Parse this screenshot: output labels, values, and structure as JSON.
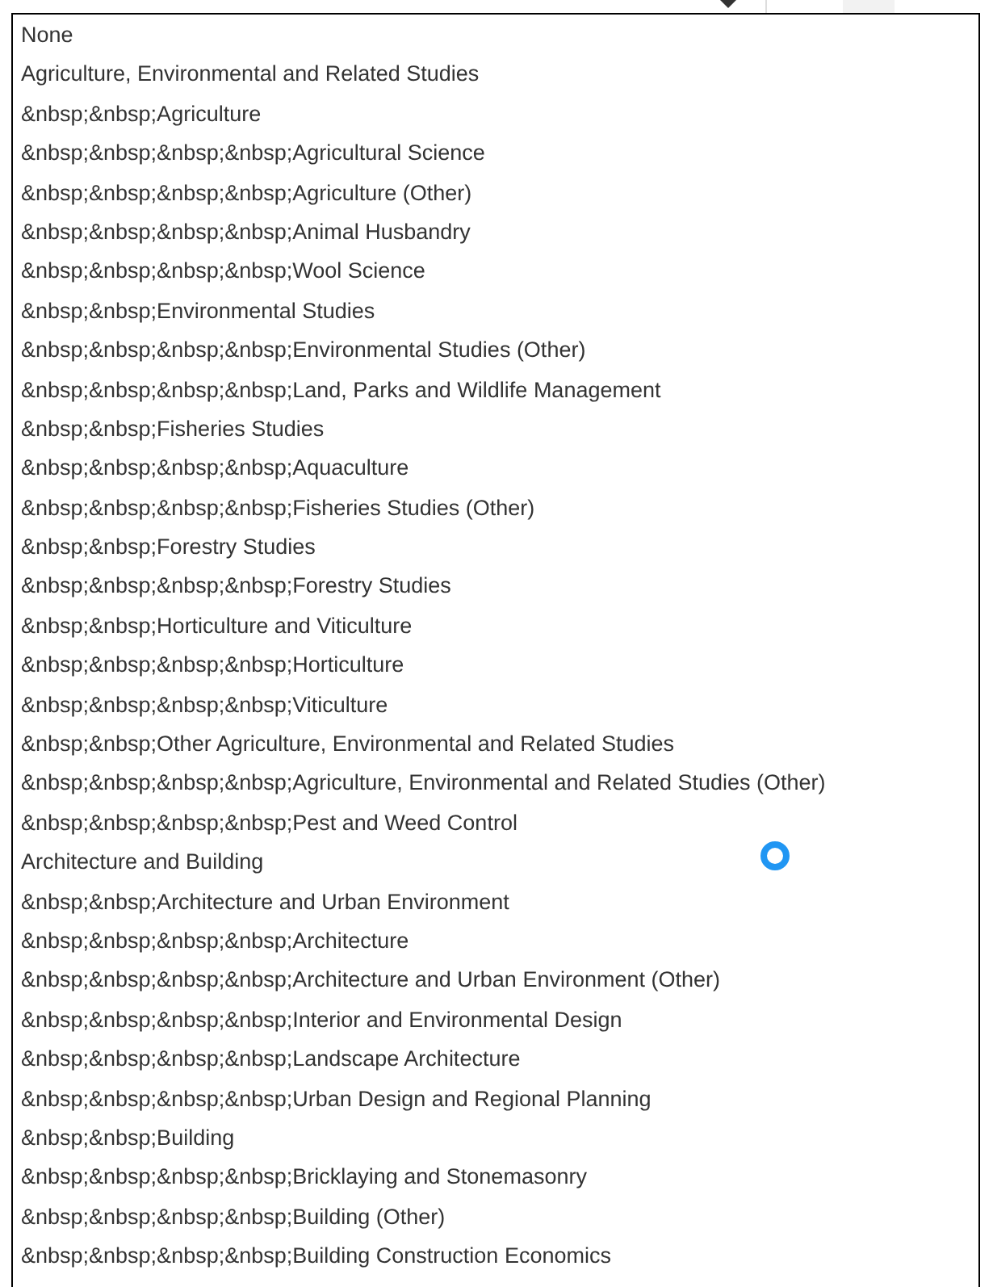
{
  "dropdown": {
    "options": [
      {
        "label": "None"
      },
      {
        "label": "Agriculture, Environmental and Related Studies"
      },
      {
        "label": "&nbsp;&nbsp;Agriculture"
      },
      {
        "label": "&nbsp;&nbsp;&nbsp;&nbsp;Agricultural Science"
      },
      {
        "label": "&nbsp;&nbsp;&nbsp;&nbsp;Agriculture (Other)"
      },
      {
        "label": "&nbsp;&nbsp;&nbsp;&nbsp;Animal Husbandry"
      },
      {
        "label": "&nbsp;&nbsp;&nbsp;&nbsp;Wool Science"
      },
      {
        "label": "&nbsp;&nbsp;Environmental Studies"
      },
      {
        "label": "&nbsp;&nbsp;&nbsp;&nbsp;Environmental Studies (Other)"
      },
      {
        "label": "&nbsp;&nbsp;&nbsp;&nbsp;Land, Parks and Wildlife Management"
      },
      {
        "label": "&nbsp;&nbsp;Fisheries Studies"
      },
      {
        "label": "&nbsp;&nbsp;&nbsp;&nbsp;Aquaculture"
      },
      {
        "label": "&nbsp;&nbsp;&nbsp;&nbsp;Fisheries Studies (Other)"
      },
      {
        "label": "&nbsp;&nbsp;Forestry Studies"
      },
      {
        "label": "&nbsp;&nbsp;&nbsp;&nbsp;Forestry Studies"
      },
      {
        "label": "&nbsp;&nbsp;Horticulture and Viticulture"
      },
      {
        "label": "&nbsp;&nbsp;&nbsp;&nbsp;Horticulture"
      },
      {
        "label": "&nbsp;&nbsp;&nbsp;&nbsp;Viticulture"
      },
      {
        "label": "&nbsp;&nbsp;Other Agriculture, Environmental and Related Studies"
      },
      {
        "label": "&nbsp;&nbsp;&nbsp;&nbsp;Agriculture, Environmental and Related Studies (Other)"
      },
      {
        "label": "&nbsp;&nbsp;&nbsp;&nbsp;Pest and Weed Control"
      },
      {
        "label": "Architecture and Building"
      },
      {
        "label": "&nbsp;&nbsp;Architecture and Urban Environment"
      },
      {
        "label": "&nbsp;&nbsp;&nbsp;&nbsp;Architecture"
      },
      {
        "label": "&nbsp;&nbsp;&nbsp;&nbsp;Architecture and Urban Environment (Other)"
      },
      {
        "label": "&nbsp;&nbsp;&nbsp;&nbsp;Interior and Environmental Design"
      },
      {
        "label": "&nbsp;&nbsp;&nbsp;&nbsp;Landscape Architecture"
      },
      {
        "label": "&nbsp;&nbsp;&nbsp;&nbsp;Urban Design and Regional Planning"
      },
      {
        "label": "&nbsp;&nbsp;Building"
      },
      {
        "label": "&nbsp;&nbsp;&nbsp;&nbsp;Bricklaying and Stonemasonry"
      },
      {
        "label": "&nbsp;&nbsp;&nbsp;&nbsp;Building (Other)"
      },
      {
        "label": "&nbsp;&nbsp;&nbsp;&nbsp;Building Construction Economics"
      }
    ]
  }
}
